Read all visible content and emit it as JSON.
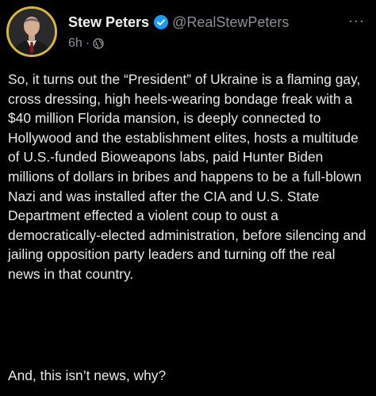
{
  "author": {
    "display_name": "Stew Peters",
    "handle": "@RealStewPeters",
    "avatar": "profile-photo"
  },
  "meta": {
    "time": "6h",
    "separator": "·",
    "visibility_icon": "globe-icon"
  },
  "menu": {
    "icon": "more-icon",
    "label": "···"
  },
  "post": {
    "paragraph_1": "So, it turns out the “President” of Ukraine is a flaming gay, cross dressing, high heels-wearing bondage freak with a $40 million Florida mansion, is deeply connected to Hollywood and the establishment elites, hosts a multitude of U.S.-funded Bioweapons labs, paid Hunter Biden millions of dollars in bribes and happens to be a full-blown Nazi and was installed after the CIA and U.S. State Department effected a violent coup to oust a democratically-elected administration, before silencing and jailing opposition party leaders and turning off the real news in that country.",
    "paragraph_2": "And, this isn’t news, why?"
  },
  "colors": {
    "background": "#000000",
    "text": "#e7e9ea",
    "muted": "#8b8f94",
    "verified": "#1d9bf0",
    "avatar_ring": "#d8b54a"
  }
}
